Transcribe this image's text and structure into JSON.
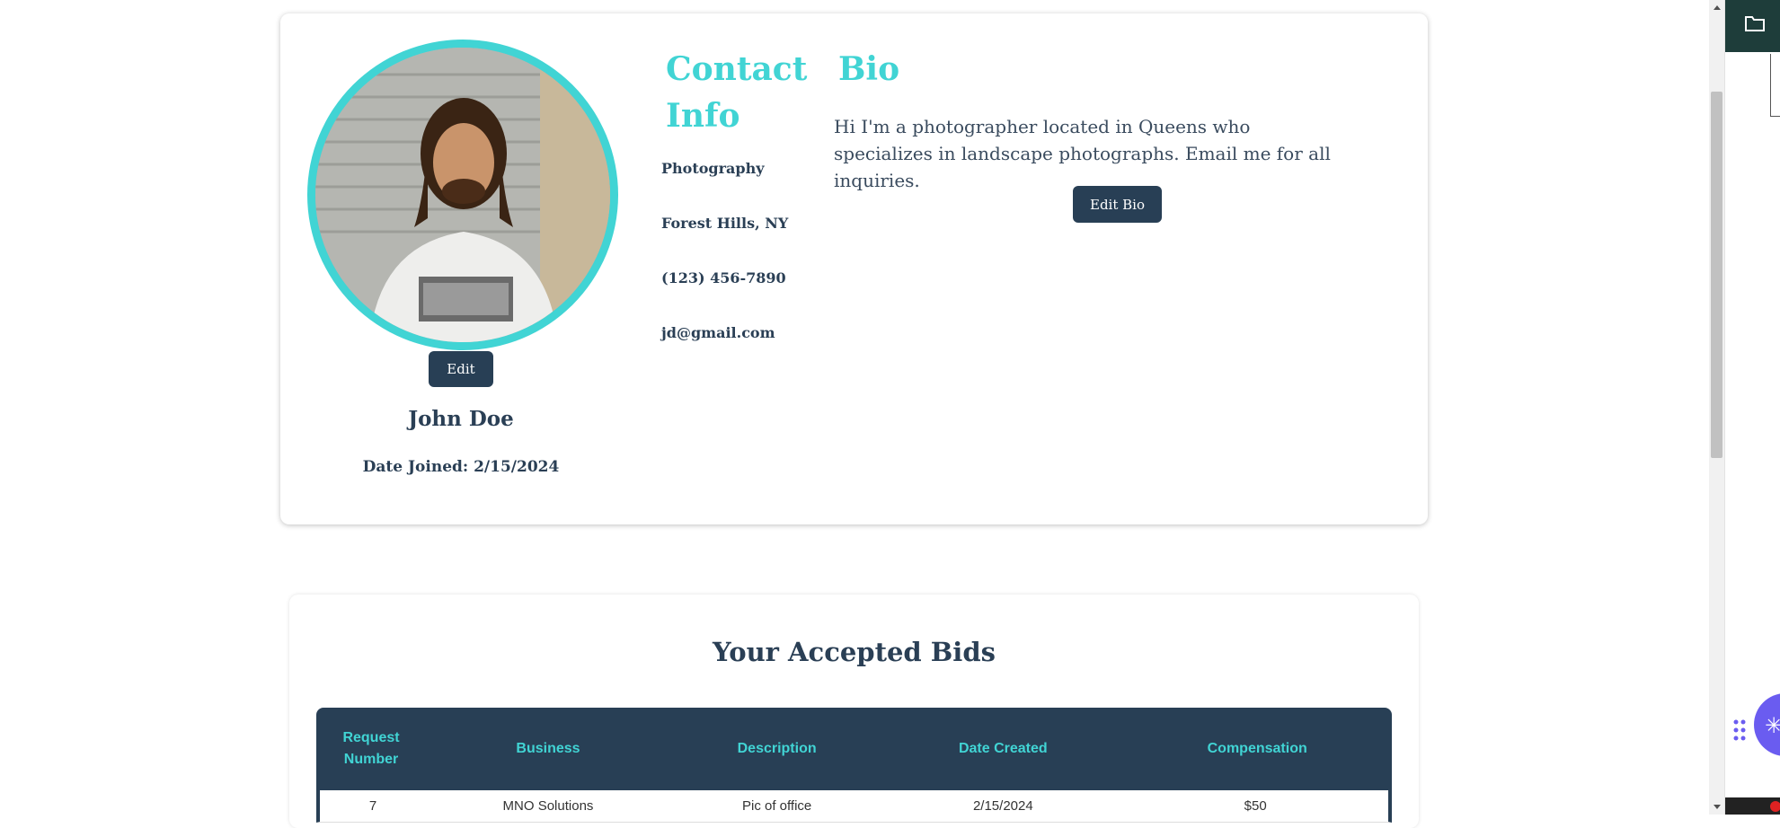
{
  "profile": {
    "name": "John Doe",
    "date_joined": "Date Joined: 2/15/2024",
    "edit_label": "Edit"
  },
  "contact": {
    "heading": "Contact Info",
    "items": [
      "Photography",
      "Forest Hills, NY",
      "(123) 456-7890",
      "jd@gmail.com"
    ]
  },
  "bio": {
    "heading": "Bio",
    "text": "Hi I'm a photographer located in Queens who specializes in landscape photographs. Email me for all inquiries.",
    "edit_label": "Edit Bio"
  },
  "bids": {
    "title": "Your Accepted Bids",
    "columns": [
      "Request Number",
      "Business",
      "Description",
      "Date Created",
      "Compensation"
    ],
    "rows": [
      [
        "7",
        "MNO Solutions",
        "Pic of office",
        "2/15/2024",
        "$50"
      ]
    ]
  },
  "colors": {
    "accent": "#41d4d4",
    "navy": "#283f55"
  },
  "icons": {
    "side_panel": "folder-icon",
    "drag": "drag-handle-icon",
    "fab": "sparkle-icon"
  }
}
